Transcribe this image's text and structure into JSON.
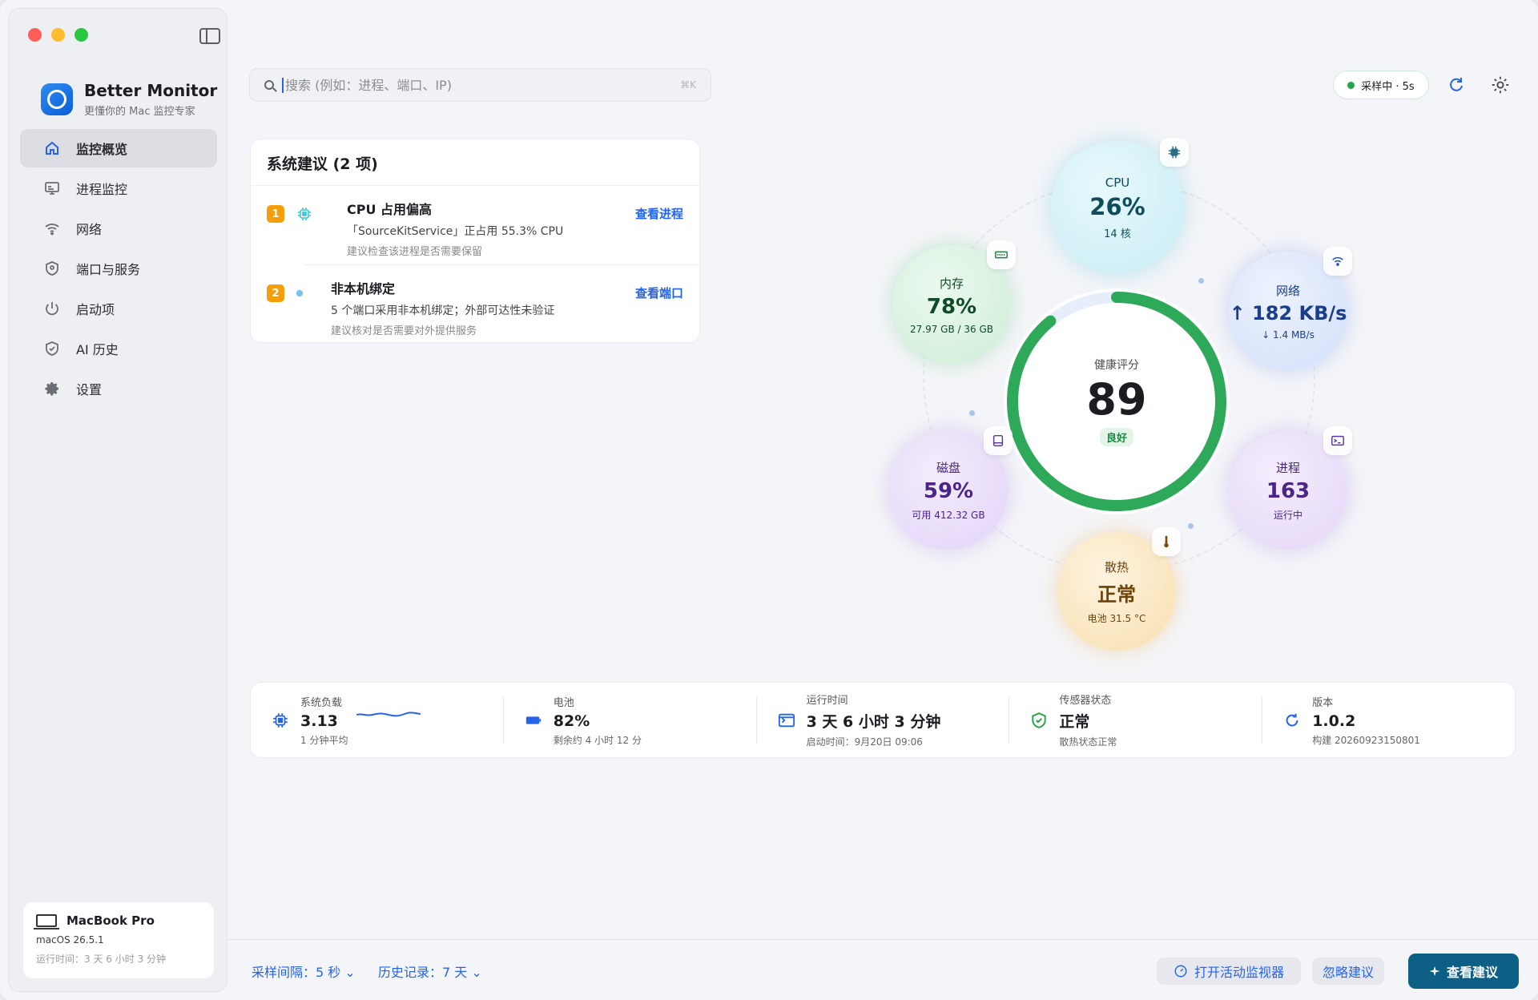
{
  "app": {
    "name": "Better Monitor",
    "tagline": "更懂你的 Mac 监控专家"
  },
  "sidebar": {
    "items": [
      {
        "label": "监控概览",
        "icon": "home-icon",
        "active": true
      },
      {
        "label": "进程监控",
        "icon": "monitor-icon"
      },
      {
        "label": "网络",
        "icon": "wifi-icon"
      },
      {
        "label": "端口与服务",
        "icon": "shield-icon"
      },
      {
        "label": "启动项",
        "icon": "power-icon"
      },
      {
        "label": "AI 历史",
        "icon": "shield-check-icon"
      },
      {
        "label": "设置",
        "icon": "gear-icon"
      }
    ],
    "device": {
      "name": "MacBook Pro",
      "os": "macOS 26.5.1",
      "uptime": "运行时间：3 天 6 小时 3 分钟"
    }
  },
  "search": {
    "placeholder": "搜索 (例如：进程、端口、IP)",
    "value": "",
    "shortcut": "⌘K"
  },
  "sampling": {
    "label": "采样中 · 5s"
  },
  "suggestions": {
    "title": "系统建议 (2 项)",
    "items": [
      {
        "num": "1",
        "title": "CPU 占用偏高",
        "desc": "「SourceKitService」正占用 55.3% CPU",
        "note": "建议检查该进程是否需要保留",
        "link": "查看进程"
      },
      {
        "num": "2",
        "title": "非本机绑定",
        "desc": "5 个端口采用非本机绑定；外部可达性未验证",
        "note": "建议核对是否需要对外提供服务",
        "link": "查看端口"
      }
    ]
  },
  "health": {
    "label": "健康评分",
    "score": "89",
    "status": "良好",
    "fraction": 0.89
  },
  "metrics": {
    "cpu": {
      "label": "CPU",
      "value": "26%",
      "sub": "14 核"
    },
    "memory": {
      "label": "内存",
      "value": "78%",
      "sub": "27.97 GB / 36 GB"
    },
    "network": {
      "label": "网络",
      "value": "↑ 182 KB/s",
      "sub": "↓ 1.4 MB/s"
    },
    "disk": {
      "label": "磁盘",
      "value": "59%",
      "sub": "可用 412.32 GB"
    },
    "process": {
      "label": "进程",
      "value": "163",
      "sub": "运行中"
    },
    "thermal": {
      "label": "散热",
      "value": "正常",
      "sub": "电池 31.5 °C"
    }
  },
  "stats": [
    {
      "label": "系统负载",
      "value": "3.13",
      "sub": "1 分钟平均",
      "icon": "chip-icon"
    },
    {
      "label": "电池",
      "value": "82%",
      "sub": "剩余约 4 小时 12 分",
      "icon": "battery-icon"
    },
    {
      "label": "运行时间",
      "value": "3 天 6 小时 3 分钟",
      "sub": "启动时间：9月20日 09:06",
      "icon": "terminal-icon"
    },
    {
      "label": "传感器状态",
      "value": "正常",
      "sub": "散热状态正常",
      "icon": "shield-check-icon"
    },
    {
      "label": "版本",
      "value": "1.0.2",
      "sub": "构建 20260923150801",
      "icon": "refresh-icon"
    }
  ],
  "bottombar": {
    "interval": "采样间隔：5 秒",
    "history": "历史记录：7 天",
    "open_activity": "打开活动监视器",
    "ignore": "忽略建议",
    "view": "查看建议"
  },
  "colors": {
    "accent": "#2563eb",
    "health_ring": "#2ea95a",
    "primary_button": "#0e5f86",
    "warning": "#f59e0b"
  }
}
